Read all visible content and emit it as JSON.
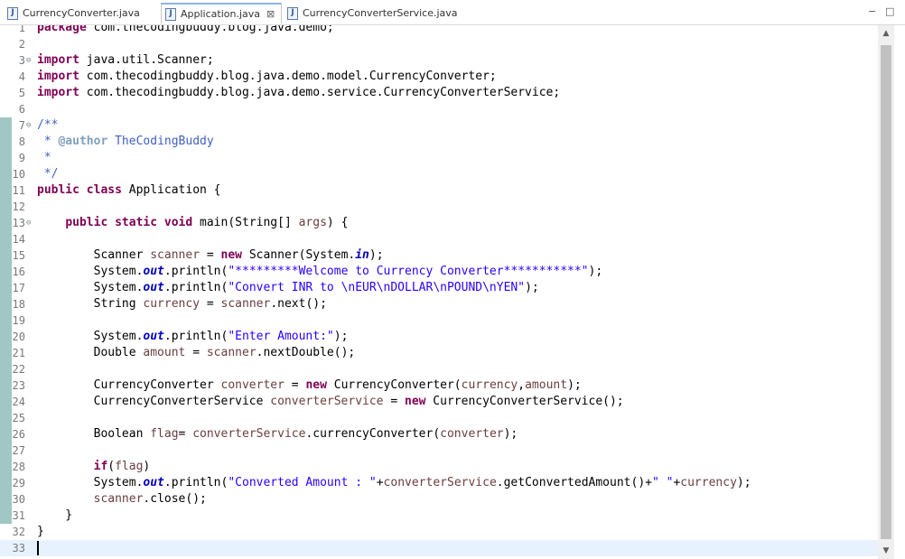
{
  "tabs": [
    {
      "label": "CurrencyConverter.java",
      "icon": "java-file-icon"
    },
    {
      "label": "Application.java",
      "icon": "java-file-icon",
      "close": "⊠",
      "active": true
    },
    {
      "label": "CurrencyConverterService.java",
      "icon": "java-file-icon"
    }
  ],
  "window_controls": {
    "minimize": "−",
    "maximize": "□"
  },
  "code": {
    "current_line": 33,
    "lines": [
      {
        "n": "1",
        "fold": false,
        "changed": false,
        "tokens": [
          [
            "kw",
            "package"
          ],
          [
            "p",
            " com.thecodingbuddy.blog.java.demo;"
          ]
        ]
      },
      {
        "n": "2",
        "fold": false,
        "changed": false,
        "tokens": []
      },
      {
        "n": "3",
        "fold": true,
        "changed": false,
        "tokens": [
          [
            "kw",
            "import"
          ],
          [
            "p",
            " java.util.Scanner;"
          ]
        ]
      },
      {
        "n": "4",
        "fold": false,
        "changed": false,
        "tokens": [
          [
            "kw",
            "import"
          ],
          [
            "p",
            " com.thecodingbuddy.blog.java.demo.model.CurrencyConverter;"
          ]
        ]
      },
      {
        "n": "5",
        "fold": false,
        "changed": false,
        "tokens": [
          [
            "kw",
            "import"
          ],
          [
            "p",
            " com.thecodingbuddy.blog.java.demo.service.CurrencyConverterService;"
          ]
        ]
      },
      {
        "n": "6",
        "fold": false,
        "changed": false,
        "tokens": []
      },
      {
        "n": "7",
        "fold": true,
        "changed": true,
        "tokens": [
          [
            "jdoc",
            "/**"
          ]
        ]
      },
      {
        "n": "8",
        "fold": false,
        "changed": true,
        "tokens": [
          [
            "jdoc",
            " * "
          ],
          [
            "tag",
            "@author"
          ],
          [
            "jdoc",
            " TheCodingBuddy"
          ]
        ]
      },
      {
        "n": "9",
        "fold": false,
        "changed": true,
        "tokens": [
          [
            "jdoc",
            " *"
          ]
        ]
      },
      {
        "n": "10",
        "fold": false,
        "changed": true,
        "tokens": [
          [
            "jdoc",
            " */"
          ]
        ]
      },
      {
        "n": "11",
        "fold": false,
        "changed": true,
        "tokens": [
          [
            "kw",
            "public class"
          ],
          [
            "p",
            " Application {"
          ]
        ]
      },
      {
        "n": "12",
        "fold": false,
        "changed": true,
        "tokens": []
      },
      {
        "n": "13",
        "fold": true,
        "changed": true,
        "tokens": [
          [
            "p",
            "    "
          ],
          [
            "kw",
            "public static void"
          ],
          [
            "p",
            " main(String[] "
          ],
          [
            "var",
            "args"
          ],
          [
            "p",
            ") {"
          ]
        ]
      },
      {
        "n": "14",
        "fold": false,
        "changed": true,
        "tokens": []
      },
      {
        "n": "15",
        "fold": false,
        "changed": true,
        "tokens": [
          [
            "p",
            "        Scanner "
          ],
          [
            "var",
            "scanner"
          ],
          [
            "p",
            " = "
          ],
          [
            "kw",
            "new"
          ],
          [
            "p",
            " Scanner(System."
          ],
          [
            "fld",
            "in"
          ],
          [
            "p",
            ");"
          ]
        ]
      },
      {
        "n": "16",
        "fold": false,
        "changed": true,
        "tokens": [
          [
            "p",
            "        System."
          ],
          [
            "fld",
            "out"
          ],
          [
            "p",
            ".println("
          ],
          [
            "str",
            "\"*********Welcome to Currency Converter***********\""
          ],
          [
            "p",
            ");"
          ]
        ]
      },
      {
        "n": "17",
        "fold": false,
        "changed": true,
        "tokens": [
          [
            "p",
            "        System."
          ],
          [
            "fld",
            "out"
          ],
          [
            "p",
            ".println("
          ],
          [
            "str",
            "\"Convert INR to \\nEUR\\nDOLLAR\\nPOUND\\nYEN\""
          ],
          [
            "p",
            ");"
          ]
        ]
      },
      {
        "n": "18",
        "fold": false,
        "changed": true,
        "tokens": [
          [
            "p",
            "        String "
          ],
          [
            "var",
            "currency"
          ],
          [
            "p",
            " = "
          ],
          [
            "var",
            "scanner"
          ],
          [
            "p",
            ".next();"
          ]
        ]
      },
      {
        "n": "19",
        "fold": false,
        "changed": true,
        "tokens": []
      },
      {
        "n": "20",
        "fold": false,
        "changed": true,
        "tokens": [
          [
            "p",
            "        System."
          ],
          [
            "fld",
            "out"
          ],
          [
            "p",
            ".println("
          ],
          [
            "str",
            "\"Enter Amount:\""
          ],
          [
            "p",
            ");"
          ]
        ]
      },
      {
        "n": "21",
        "fold": false,
        "changed": true,
        "tokens": [
          [
            "p",
            "        Double "
          ],
          [
            "var",
            "amount"
          ],
          [
            "p",
            " = "
          ],
          [
            "var",
            "scanner"
          ],
          [
            "p",
            ".nextDouble();"
          ]
        ]
      },
      {
        "n": "22",
        "fold": false,
        "changed": true,
        "tokens": []
      },
      {
        "n": "23",
        "fold": false,
        "changed": true,
        "tokens": [
          [
            "p",
            "        CurrencyConverter "
          ],
          [
            "var",
            "converter"
          ],
          [
            "p",
            " = "
          ],
          [
            "kw",
            "new"
          ],
          [
            "p",
            " CurrencyConverter("
          ],
          [
            "var",
            "currency"
          ],
          [
            "p",
            ","
          ],
          [
            "var",
            "amount"
          ],
          [
            "p",
            ");"
          ]
        ]
      },
      {
        "n": "24",
        "fold": false,
        "changed": true,
        "tokens": [
          [
            "p",
            "        CurrencyConverterService "
          ],
          [
            "var",
            "converterService"
          ],
          [
            "p",
            " = "
          ],
          [
            "kw",
            "new"
          ],
          [
            "p",
            " CurrencyConverterService();"
          ]
        ]
      },
      {
        "n": "25",
        "fold": false,
        "changed": true,
        "tokens": []
      },
      {
        "n": "26",
        "fold": false,
        "changed": true,
        "tokens": [
          [
            "p",
            "        Boolean "
          ],
          [
            "var",
            "flag"
          ],
          [
            "p",
            "= "
          ],
          [
            "var",
            "converterService"
          ],
          [
            "p",
            ".currencyConverter("
          ],
          [
            "var",
            "converter"
          ],
          [
            "p",
            ");"
          ]
        ]
      },
      {
        "n": "27",
        "fold": false,
        "changed": true,
        "tokens": []
      },
      {
        "n": "28",
        "fold": false,
        "changed": true,
        "tokens": [
          [
            "p",
            "        "
          ],
          [
            "kw",
            "if"
          ],
          [
            "p",
            "("
          ],
          [
            "var",
            "flag"
          ],
          [
            "p",
            ")"
          ]
        ]
      },
      {
        "n": "29",
        "fold": false,
        "changed": true,
        "tokens": [
          [
            "p",
            "        System."
          ],
          [
            "fld",
            "out"
          ],
          [
            "p",
            ".println("
          ],
          [
            "str",
            "\"Converted Amount : \""
          ],
          [
            "p",
            "+"
          ],
          [
            "var",
            "converterService"
          ],
          [
            "p",
            ".getConvertedAmount()+"
          ],
          [
            "str",
            "\" \""
          ],
          [
            "p",
            "+"
          ],
          [
            "var",
            "currency"
          ],
          [
            "p",
            ");"
          ]
        ]
      },
      {
        "n": "30",
        "fold": false,
        "changed": true,
        "tokens": [
          [
            "p",
            "        "
          ],
          [
            "var",
            "scanner"
          ],
          [
            "p",
            ".close();"
          ]
        ]
      },
      {
        "n": "31",
        "fold": false,
        "changed": true,
        "tokens": [
          [
            "p",
            "    }"
          ]
        ]
      },
      {
        "n": "32",
        "fold": false,
        "changed": false,
        "tokens": [
          [
            "p",
            "}"
          ]
        ]
      },
      {
        "n": "33",
        "fold": false,
        "changed": false,
        "tokens": []
      }
    ]
  }
}
